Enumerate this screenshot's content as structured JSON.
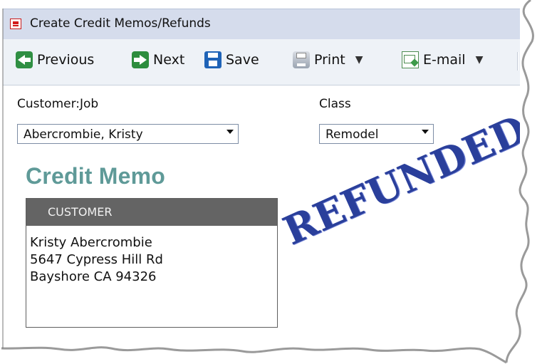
{
  "window": {
    "title": "Create Credit Memos/Refunds"
  },
  "toolbar": {
    "previous": "Previous",
    "next": "Next",
    "save": "Save",
    "print": "Print",
    "email": "E-mail",
    "more_icon": "euro-icon"
  },
  "form": {
    "customer_job_label": "Customer:Job",
    "customer_job_value": "Abercrombie, Kristy",
    "class_label": "Class",
    "class_value": "Remodel",
    "title": "Credit Memo",
    "customer_header": "CUSTOMER",
    "address_line_1": "Kristy Abercrombie",
    "address_line_2": "5647 Cypress Hill Rd",
    "address_line_3": "Bayshore CA 94326",
    "stamp": "REFUNDED"
  },
  "colors": {
    "title_teal": "#5f9a98",
    "stamp_blue": "#2a3f9b",
    "header_gray": "#646464"
  }
}
